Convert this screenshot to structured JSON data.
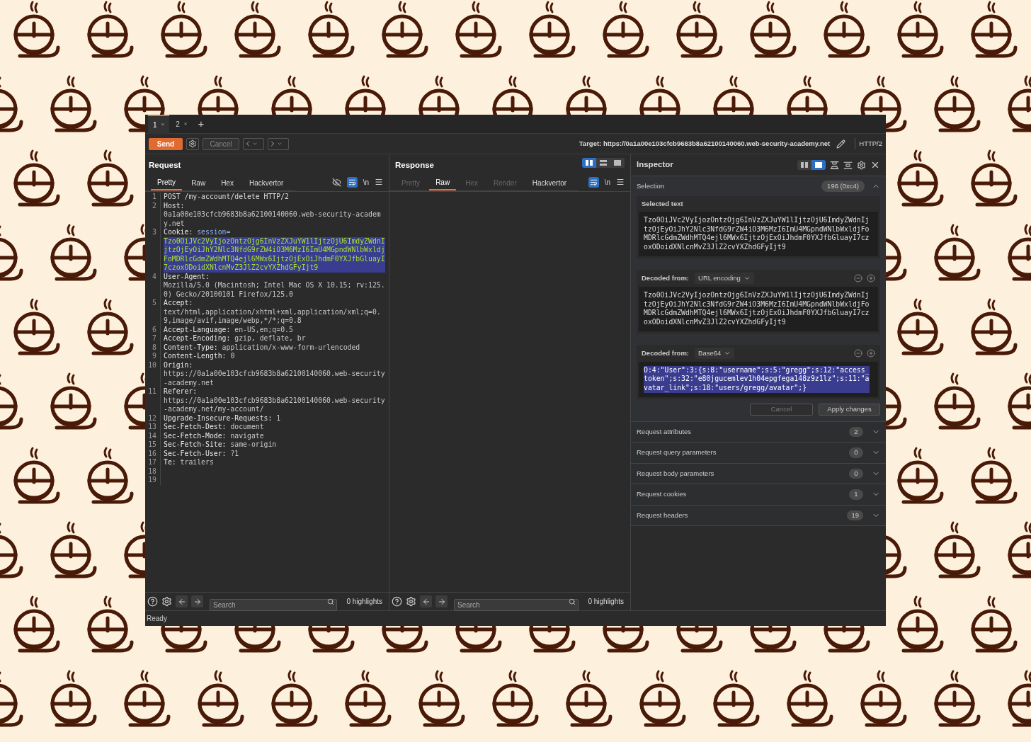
{
  "tabs": [
    {
      "label": "1",
      "close": "×",
      "selected": true
    },
    {
      "label": "2",
      "close": "×",
      "selected": false
    }
  ],
  "new_tab": "+",
  "toolbar": {
    "send": "Send",
    "cancel": {
      "label": "Cancel",
      "disabled": true
    },
    "target": "Target: https://0a1a00e103cfcb9683b8a62100140060.web-security-academy.net",
    "protocol": "HTTP/2"
  },
  "request": {
    "title": "Request",
    "tabs": [
      {
        "label": "Pretty",
        "selected": true,
        "disabled": false
      },
      {
        "label": "Raw",
        "selected": false,
        "disabled": false
      },
      {
        "label": "Hex",
        "selected": false,
        "disabled": false
      },
      {
        "label": "Hackvertor",
        "selected": false,
        "disabled": false
      }
    ],
    "hide_nonprintable": false,
    "word_wrap": true,
    "newline_toggle": "\\n",
    "lines": [
      {
        "number": "1",
        "text": "POST /my-account/delete HTTP/2"
      },
      {
        "number": "2",
        "name": "Host:",
        "value": "0a1a00e103cfcb9683b8a62100140060.web-security-academy.net"
      },
      {
        "number": "3",
        "name": "Cookie:",
        "value": "session=",
        "selection": "Tzo0OiJVc2VyIjozOntzOjg6InVzZXJuYW1lIjtzOjU6ImdyZWdnIjtzOjEyOiJhY2Nlc3NfdG9rZW4iO3M6MzI6ImU4MGpndWNlbWxldjFoMDRlcGdmZWdhMTQ4ejl6MWx6IjtzOjExOiJhdmF0YXJfbGluayI7czoxODoidXNlcnMvZ3JlZ2cvYXZhdGFyIjt9"
      },
      {
        "number": "4",
        "name": "User-Agent:",
        "value": "Mozilla/5.0 (Macintosh; Intel Mac OS X 10.15; rv:125.0) Gecko/20100101 Firefox/125.0"
      },
      {
        "number": "5",
        "name": "Accept:",
        "value": "text/html,application/xhtml+xml,application/xml;q=0.9,image/avif,image/webp,*/*;q=0.8"
      },
      {
        "number": "6",
        "name": "Accept-Language:",
        "value": "en-US,en;q=0.5"
      },
      {
        "number": "7",
        "name": "Accept-Encoding:",
        "value": "gzip, deflate, br"
      },
      {
        "number": "8",
        "name": "Content-Type:",
        "value": "application/x-www-form-urlencoded"
      },
      {
        "number": "9",
        "name": "Content-Length:",
        "value": "0"
      },
      {
        "number": "10",
        "name": "Origin:",
        "value": "https://0a1a00e103cfcb9683b8a62100140060.web-security-academy.net"
      },
      {
        "number": "11",
        "name": "Referer:",
        "value": "https://0a1a00e103cfcb9683b8a62100140060.web-security-academy.net/my-account/"
      },
      {
        "number": "12",
        "name": "Upgrade-Insecure-Requests:",
        "value": "1"
      },
      {
        "number": "13",
        "name": "Sec-Fetch-Dest:",
        "value": "document"
      },
      {
        "number": "14",
        "name": "Sec-Fetch-Mode:",
        "value": "navigate"
      },
      {
        "number": "15",
        "name": "Sec-Fetch-Site:",
        "value": "same-origin"
      },
      {
        "number": "16",
        "name": "Sec-Fetch-User:",
        "value": "?1"
      },
      {
        "number": "17",
        "name": "Te:",
        "value": "trailers"
      },
      {
        "number": "18"
      },
      {
        "number": "19"
      }
    ],
    "search": {
      "placeholder": "Search"
    },
    "highlights": "0 highlights"
  },
  "response": {
    "title": "Response",
    "layout_buttons": [
      {
        "selected": true
      },
      {
        "selected": false
      },
      {
        "selected": false
      }
    ],
    "tabs": [
      {
        "label": "Pretty",
        "selected": false,
        "disabled": true
      },
      {
        "label": "Raw",
        "selected": true,
        "disabled": false
      },
      {
        "label": "Hex",
        "selected": false,
        "disabled": true
      },
      {
        "label": "Render",
        "selected": false,
        "disabled": true
      },
      {
        "label": "Hackvertor",
        "selected": false,
        "disabled": false
      }
    ],
    "word_wrap": true,
    "newline_toggle": "\\n",
    "search": {
      "placeholder": "Search"
    },
    "highlights": "0 highlights"
  },
  "inspector": {
    "title": "Inspector",
    "layout_buttons": [
      {
        "selected": false
      },
      {
        "selected": true
      }
    ],
    "selection": {
      "label": "Selection",
      "count": "196 (0xc4)",
      "expanded": true
    },
    "selected_text": {
      "title": "Selected text",
      "text": "Tzo0OiJVc2VyIjozOntzOjg6InVzZXJuYW1lIjtzOjU6ImdyZWdnIjtzOjEyOiJhY2Nlc3NfdG9rZW4iO3M6MzI6ImU4MGpndWNlbWxldjFoMDRlcGdmZWdhMTQ4ejl6MWx6IjtzOjExOiJhdmF0YXJfbGluayI7czoxODoidXNlcnMvZ3JlZ2cvYXZhdGFyIjt9"
    },
    "decoders": [
      {
        "label": "Decoded from:",
        "encoding": "URL encoding",
        "highlighted": false,
        "text": "Tzo0OiJVc2VyIjozOntzOjg6InVzZXJuYW1lIjtzOjU6ImdyZWdnIjtzOjEyOiJhY2Nlc3NfdG9rZW4iO3M6MzI6ImU4MGpndWNlbWxldjFoMDRlcGdmZWdhMTQ4ejl6MWx6IjtzOjExOiJhdmF0YXJfbGluayI7czoxODoidXNlcnMvZ3JlZ2cvYXZhdGFyIjt9"
      },
      {
        "label": "Decoded from:",
        "encoding": "Base64",
        "highlighted": true,
        "text": "O:4:\"User\":3:{s:8:\"username\";s:5:\"gregg\";s:12:\"access_token\";s:32:\"e80jgucemlev1h04epgfega148z9z1lz\";s:11:\"avatar_link\";s:18:\"users/gregg/avatar\";}"
      }
    ],
    "buttons": [
      {
        "label": "Cancel",
        "disabled": true
      },
      {
        "label": "Apply changes",
        "disabled": false
      }
    ],
    "sections": [
      {
        "label": "Request attributes",
        "count": "2",
        "expanded": false
      },
      {
        "label": "Request query parameters",
        "count": "0",
        "expanded": false
      },
      {
        "label": "Request body parameters",
        "count": "0",
        "expanded": false
      },
      {
        "label": "Request cookies",
        "count": "1",
        "expanded": false
      },
      {
        "label": "Request headers",
        "count": "19",
        "expanded": false
      }
    ]
  },
  "status_bar": "Ready"
}
